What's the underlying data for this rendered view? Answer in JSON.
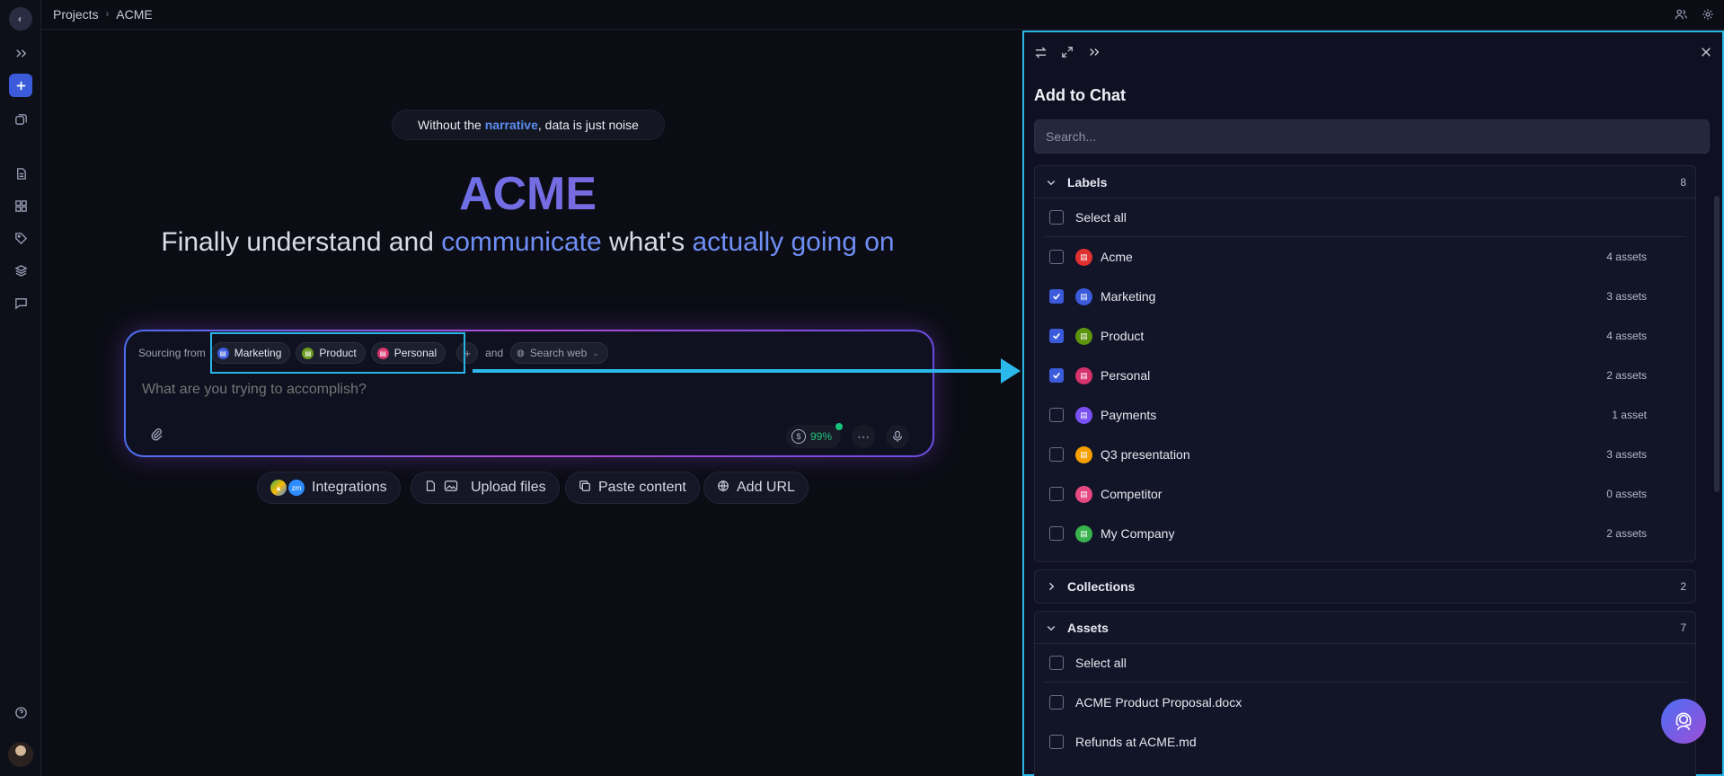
{
  "breadcrumb": {
    "root": "Projects",
    "current": "ACME"
  },
  "hero": {
    "tag_prefix": "Without the ",
    "tag_highlight": "narrative",
    "tag_suffix": ", data is just noise",
    "title": "ACME",
    "sub_1": "Finally understand and ",
    "sub_2": "communicate",
    "sub_3": " what's ",
    "sub_4": "actually going on"
  },
  "prompt": {
    "sourcing_label": "Sourcing from",
    "chips": [
      {
        "label": "Marketing",
        "color": "#3b5bdb"
      },
      {
        "label": "Product",
        "color": "#6a9a1f"
      },
      {
        "label": "Personal",
        "color": "#d6336c"
      }
    ],
    "and_label": "and",
    "search_web_label": "Search web",
    "placeholder": "What are you trying to accomplish?",
    "credit": "99%"
  },
  "quick_actions": {
    "integrations": "Integrations",
    "integrations_badge": "zm",
    "upload": "Upload files",
    "paste": "Paste content",
    "add_url": "Add URL"
  },
  "panel": {
    "title": "Add to Chat",
    "search_placeholder": "Search...",
    "labels": {
      "title": "Labels",
      "count": "8",
      "select_all": "Select all",
      "items": [
        {
          "name": "Acme",
          "assets": "4 assets",
          "checked": false,
          "color": "#e03131"
        },
        {
          "name": "Marketing",
          "assets": "3 assets",
          "checked": true,
          "color": "#3b5bdb"
        },
        {
          "name": "Product",
          "assets": "4 assets",
          "checked": true,
          "color": "#5c940d"
        },
        {
          "name": "Personal",
          "assets": "2 assets",
          "checked": true,
          "color": "#d6336c"
        },
        {
          "name": "Payments",
          "assets": "1 asset",
          "checked": false,
          "color": "#7950f2"
        },
        {
          "name": "Q3 presentation",
          "assets": "3 assets",
          "checked": false,
          "color": "#f59f00"
        },
        {
          "name": "Competitor",
          "assets": "0 assets",
          "checked": false,
          "color": "#e64980"
        },
        {
          "name": "My Company",
          "assets": "2 assets",
          "checked": false,
          "color": "#37b24d"
        }
      ]
    },
    "collections": {
      "title": "Collections",
      "count": "2"
    },
    "assets": {
      "title": "Assets",
      "count": "7",
      "select_all": "Select all",
      "items": [
        {
          "name": "ACME Product Proposal.docx"
        },
        {
          "name": "Refunds at ACME.md"
        }
      ]
    }
  }
}
